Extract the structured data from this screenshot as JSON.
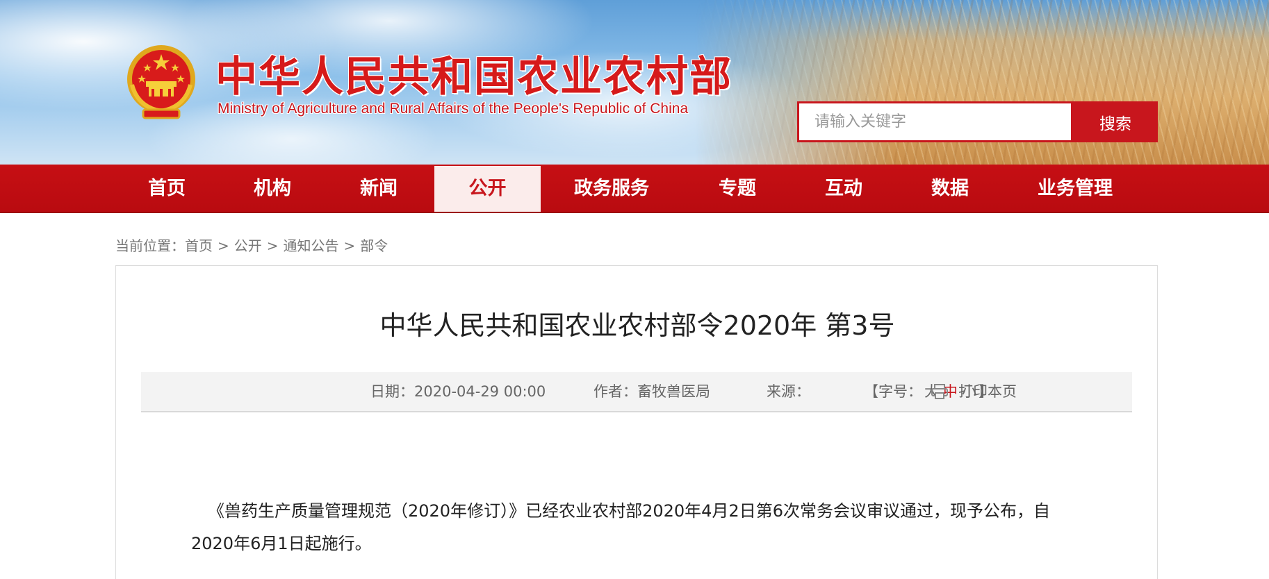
{
  "header": {
    "title_cn": "中华人民共和国农业农村部",
    "title_en": "Ministry of Agriculture and Rural Affairs of the People's Republic of China",
    "emblem_icon": "national-emblem-icon",
    "search": {
      "placeholder": "请输入关键字",
      "value": "",
      "button_label": "搜索"
    },
    "colors": {
      "brand_red": "#c8161d",
      "nav_red": "#c60f14",
      "active_tab_bg": "#fbeceb"
    }
  },
  "nav": {
    "items": [
      {
        "label": "首页",
        "active": false
      },
      {
        "label": "机构",
        "active": false
      },
      {
        "label": "新闻",
        "active": false
      },
      {
        "label": "公开",
        "active": true
      },
      {
        "label": "政务服务",
        "active": false
      },
      {
        "label": "专题",
        "active": false
      },
      {
        "label": "互动",
        "active": false
      },
      {
        "label": "数据",
        "active": false
      },
      {
        "label": "业务管理",
        "active": false
      }
    ]
  },
  "breadcrumb": {
    "prefix": "当前位置：",
    "items": [
      "首页",
      "公开",
      "通知公告",
      "部令"
    ],
    "separator": ">"
  },
  "article": {
    "title": "中华人民共和国农业农村部令2020年 第3号",
    "meta": {
      "date_label": "日期：",
      "date": "2020-04-29 00:00",
      "author_label": "作者：",
      "author": "畜牧兽医局",
      "source_label": "来源：",
      "source": "",
      "font_size_open": "【字号：",
      "font_size_large": "大",
      "font_size_medium": "中",
      "font_size_small": "小",
      "font_size_close": "】",
      "font_size_selected": "中",
      "print_label": "打印本页",
      "print_icon": "printer-icon"
    },
    "paragraphs": [
      "《兽药生产质量管理规范（2020年修订）》已经农业农村部2020年4月2日第6次常务会议审议通过，现予公布，自2020年6月1日起施行。"
    ]
  }
}
